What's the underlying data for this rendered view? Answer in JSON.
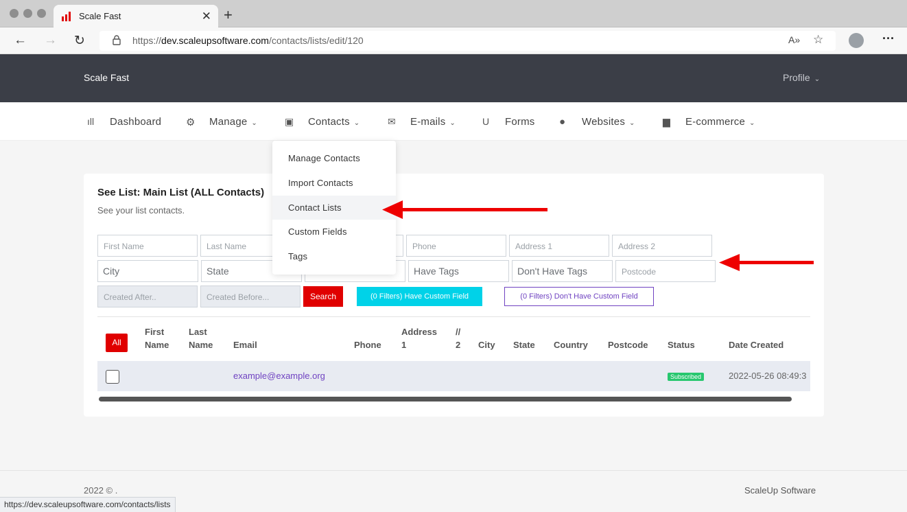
{
  "browser": {
    "tab_title": "Scale Fast",
    "url_prefix": "https://",
    "url_host": "dev.scaleupsoftware.com",
    "url_path": "/contacts/lists/edit/120",
    "status_url": "https://dev.scaleupsoftware.com/contacts/lists"
  },
  "header": {
    "brand": "Scale Fast",
    "profile": "Profile"
  },
  "nav": {
    "dashboard": "Dashboard",
    "manage": "Manage",
    "contacts": "Contacts",
    "emails": "E-mails",
    "forms": "Forms",
    "websites": "Websites",
    "ecommerce": "E-commerce"
  },
  "dropdown": {
    "items": [
      "Manage Contacts",
      "Import Contacts",
      "Contact Lists",
      "Custom Fields",
      "Tags"
    ],
    "highlighted": "Contact Lists"
  },
  "card": {
    "title": "See List: Main List (ALL Contacts)",
    "subtitle": "See your list contacts."
  },
  "filters": {
    "first_name": "First Name",
    "last_name": "Last Name",
    "phone": "Phone",
    "address1": "Address 1",
    "address2": "Address 2",
    "city": "City",
    "state": "State",
    "have_tags": "Have Tags",
    "dont_have_tags": "Don't Have Tags",
    "postcode": "Postcode",
    "created_after": "Created After..",
    "created_before": "Created Before...",
    "search": "Search",
    "have_custom": "(0 Filters) Have Custom Field",
    "dont_have_custom": "(0 Filters) Don't Have Custom Field"
  },
  "table": {
    "all_button": "All",
    "headers": {
      "first_name_1": "First",
      "first_name_2": "Name",
      "last_name_1": "Last",
      "last_name_2": "Name",
      "email": "Email",
      "phone": "Phone",
      "address1_1": "Address",
      "address1_2": "1",
      "address2_1": "//",
      "address2_2": "2",
      "city": "City",
      "state": "State",
      "country": "Country",
      "postcode": "Postcode",
      "status": "Status",
      "date_created": "Date Created"
    },
    "rows": [
      {
        "email": "example@example.org",
        "status": "Subscribed",
        "date_created": "2022-05-26 08:49:3"
      }
    ]
  },
  "footer": {
    "copyright": "2022 © .",
    "brand": "ScaleUp Software"
  },
  "colors": {
    "accent_red": "#e00000",
    "cyan": "#00d2e8",
    "purple": "#6f42c1",
    "header_bg": "#3b3e47",
    "subscribed": "#28c76f"
  }
}
